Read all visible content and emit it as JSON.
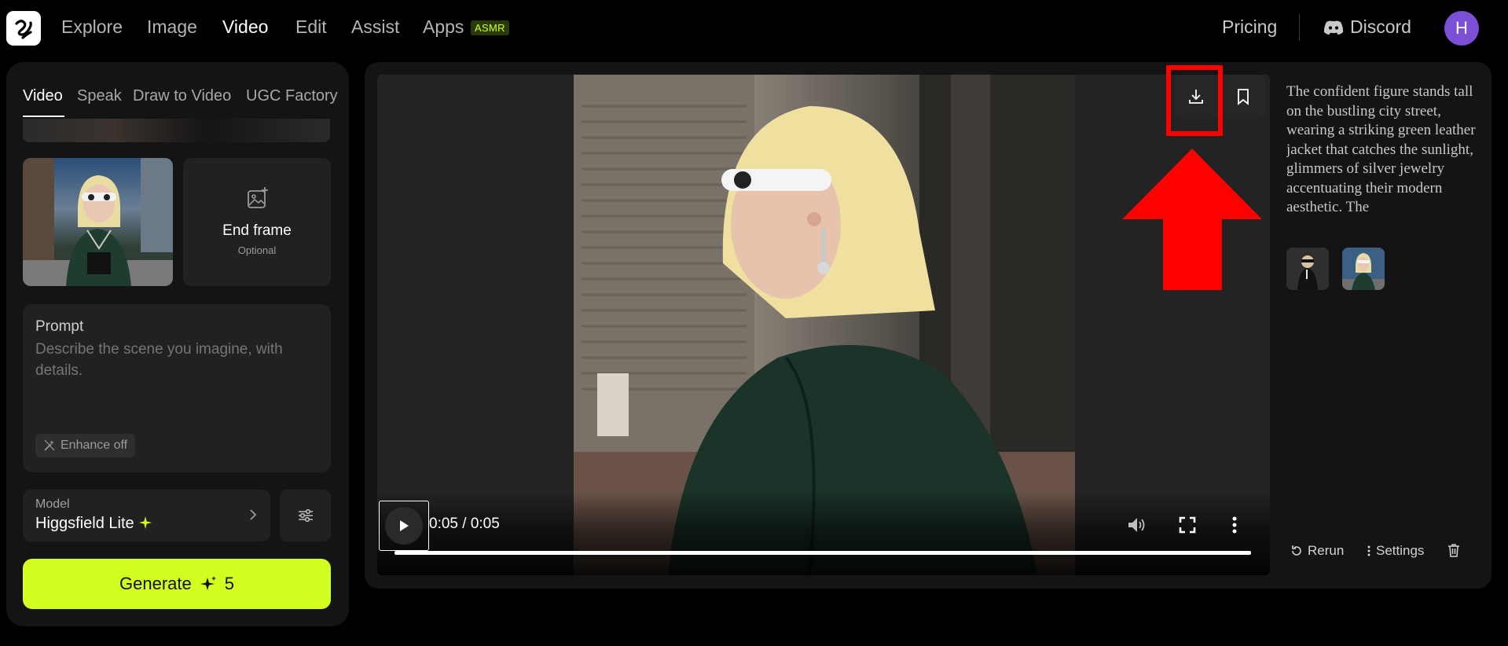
{
  "nav": {
    "items": [
      {
        "label": "Explore"
      },
      {
        "label": "Image"
      },
      {
        "label": "Video"
      },
      {
        "label": "Edit"
      },
      {
        "label": "Assist"
      },
      {
        "label": "Apps"
      }
    ],
    "apps_badge": "ASMR",
    "pricing": "Pricing",
    "discord": "Discord",
    "avatar_initial": "H",
    "avatar_color": "#7b4fd6"
  },
  "left_panel": {
    "tabs": [
      {
        "label": "Video"
      },
      {
        "label": "Speak"
      },
      {
        "label": "Draw to Video"
      },
      {
        "label": "UGC Factory"
      }
    ],
    "end_frame": {
      "title": "End frame",
      "subtitle": "Optional"
    },
    "prompt": {
      "label": "Prompt",
      "placeholder": "Describe the scene you imagine, with details."
    },
    "enhance": "Enhance off",
    "model": {
      "label": "Model",
      "value": "Higgsfield Lite"
    },
    "generate": {
      "label": "Generate",
      "cost": "5"
    },
    "accent": "#d2ff1f"
  },
  "player": {
    "time": "0:05 / 0:05",
    "progress_fraction": 1.0
  },
  "details": {
    "description": "The confident figure stands tall on the bustling city street, wearing a striking green leather jacket that catches the sunlight, glimmers of silver jewelry accentuating their modern aesthetic. The",
    "actions": {
      "rerun": "Rerun",
      "settings": "Settings"
    }
  },
  "annotation_color": "#ff0000"
}
